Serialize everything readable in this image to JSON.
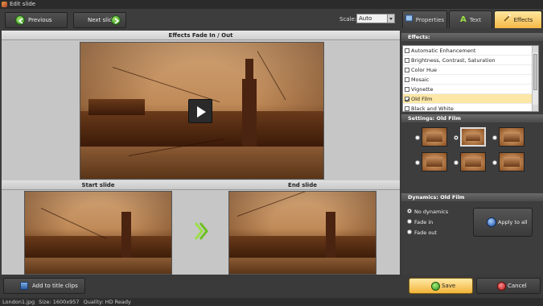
{
  "window": {
    "title": "Edit slide"
  },
  "toolbar": {
    "prev_label": "Previous slide",
    "next_label": "Next slide",
    "scale_label": "Scale:",
    "scale_value": "Auto"
  },
  "preview": {
    "title": "Effects Fade In / Out",
    "start_label": "Start slide",
    "end_label": "End slide"
  },
  "tabs": [
    {
      "label": "Properties",
      "icon": "properties-icon",
      "active": false
    },
    {
      "label": "Text",
      "icon": "text-a-icon",
      "active": false
    },
    {
      "label": "Effects",
      "icon": "wand-icon",
      "active": true
    }
  ],
  "effects": {
    "header": "Effects:",
    "items": [
      {
        "label": "Automatic Enhancement",
        "checked": false
      },
      {
        "label": "Brightness, Contrast, Saturation",
        "checked": false
      },
      {
        "label": "Color Hue",
        "checked": false
      },
      {
        "label": "Mosaic",
        "checked": false
      },
      {
        "label": "Vignette",
        "checked": false
      },
      {
        "label": "Old Film",
        "checked": true
      },
      {
        "label": "Black and White",
        "checked": false
      }
    ]
  },
  "settings": {
    "header": "Settings: Old Film",
    "selected_index": 1
  },
  "dynamics": {
    "header": "Dynamics: Old Film",
    "options": [
      "No dynamics",
      "Fade in",
      "Fade out"
    ],
    "selected": "No dynamics",
    "apply_label": "Apply to all"
  },
  "bottom": {
    "add_label": "Add to title clips",
    "save_label": "Save",
    "cancel_label": "Cancel"
  },
  "status": {
    "file": "London1.jpg",
    "size": "Size: 1600x957",
    "quality": "Quality: HD Ready"
  },
  "colors": {
    "accent": "#f4b846",
    "sepia_light": "#cfa274",
    "sepia_dark": "#5a3218"
  }
}
